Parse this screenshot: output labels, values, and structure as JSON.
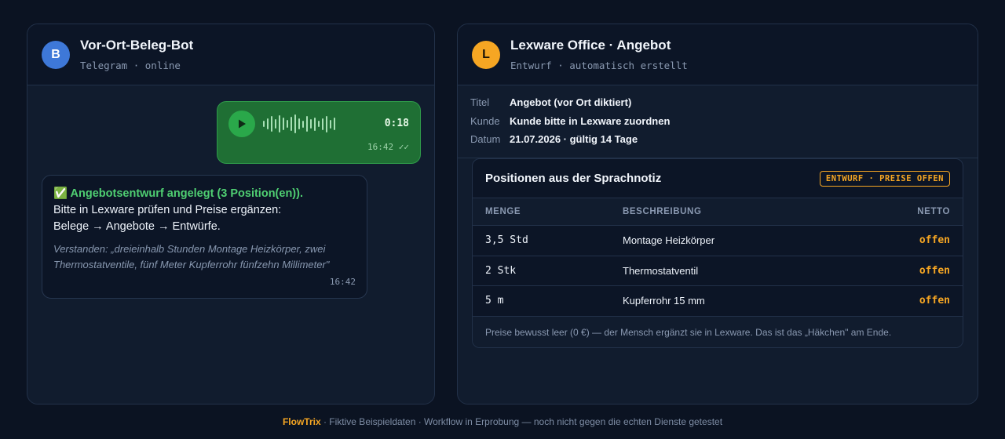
{
  "chat": {
    "avatar_letter": "B",
    "title": "Vor-Ort-Beleg-Bot",
    "subtitle": "Telegram · online",
    "voice_note": {
      "duration": "0:18",
      "time": "16:42 ✓✓"
    },
    "bot_message": {
      "headline": "✅ Angebotsentwurf angelegt (3 Position(en)).",
      "line2": "Bitte in Lexware prüfen und Preise ergänzen:",
      "line3": "Belege → Angebote → Entwürfe.",
      "quote": "Verstanden: „dreieinhalb Stunden Montage Heizkörper, zwei Thermostatventile, fünf Meter Kupferrohr fünfzehn Millimeter\"",
      "time": "16:42"
    }
  },
  "offer": {
    "avatar_letter": "L",
    "title": "Lexware Office · Angebot",
    "subtitle": "Entwurf · automatisch erstellt",
    "meta": [
      {
        "key": "Titel",
        "value": "Angebot (vor Ort diktiert)"
      },
      {
        "key": "Kunde",
        "value": "Kunde bitte in Lexware zuordnen"
      },
      {
        "key": "Datum",
        "value": "21.07.2026 · gültig 14 Tage"
      }
    ],
    "card_title": "Positionen aus der Sprachnotiz",
    "badge": "ENTWURF · PREISE OFFEN",
    "columns": {
      "qty": "MENGE",
      "desc": "BESCHREIBUNG",
      "net": "NETTO"
    },
    "rows": [
      {
        "qty": "3,5 Std",
        "desc": "Montage Heizkörper",
        "net": "offen"
      },
      {
        "qty": "2 Stk",
        "desc": "Thermostatventil",
        "net": "offen"
      },
      {
        "qty": "5 m",
        "desc": "Kupferrohr 15 mm",
        "net": "offen"
      }
    ],
    "footnote": "Preise bewusst leer (0 €) — der Mensch ergänzt sie in Lexware. Das ist das „Häkchen\" am Ende."
  },
  "footer": {
    "brand": "FlowTrix",
    "text": " · Fiktive Beispieldaten · Workflow in Erprobung — noch nicht gegen die echten Dienste getestet"
  },
  "colors": {
    "background": "#0b1322",
    "panel": "#111c2e",
    "accent_amber": "#f6a623",
    "accent_green": "#4fcf72",
    "telegram_blue": "#3e78d8"
  },
  "icons": {
    "play": "play-icon",
    "waveform": "waveform-icon",
    "read_receipt": "double-check-icon"
  }
}
